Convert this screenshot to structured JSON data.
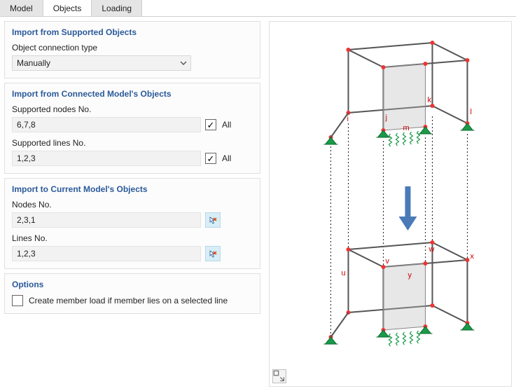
{
  "tabs": {
    "model": "Model",
    "objects": "Objects",
    "loading": "Loading",
    "active": "objects"
  },
  "panels": {
    "supported": {
      "title": "Import from Supported Objects",
      "conn_label": "Object connection type",
      "conn_value": "Manually"
    },
    "connected": {
      "title": "Import from Connected Model's Objects",
      "nodes_label": "Supported nodes No.",
      "nodes_value": "6,7,8",
      "lines_label": "Supported lines No.",
      "lines_value": "1,2,3",
      "all_label": "All"
    },
    "current": {
      "title": "Import to Current Model's Objects",
      "nodes_label": "Nodes No.",
      "nodes_value": "2,3,1",
      "lines_label": "Lines No.",
      "lines_value": "1,2,3"
    },
    "options": {
      "title": "Options",
      "cb_label": "Create member load if member lies on a selected line"
    }
  },
  "diagram_labels": {
    "top": {
      "i": "i",
      "j": "j",
      "k": "k",
      "l": "l",
      "m": "m"
    },
    "bottom": {
      "u": "u",
      "v": "v",
      "w": "w",
      "x": "x",
      "y": "y"
    }
  }
}
